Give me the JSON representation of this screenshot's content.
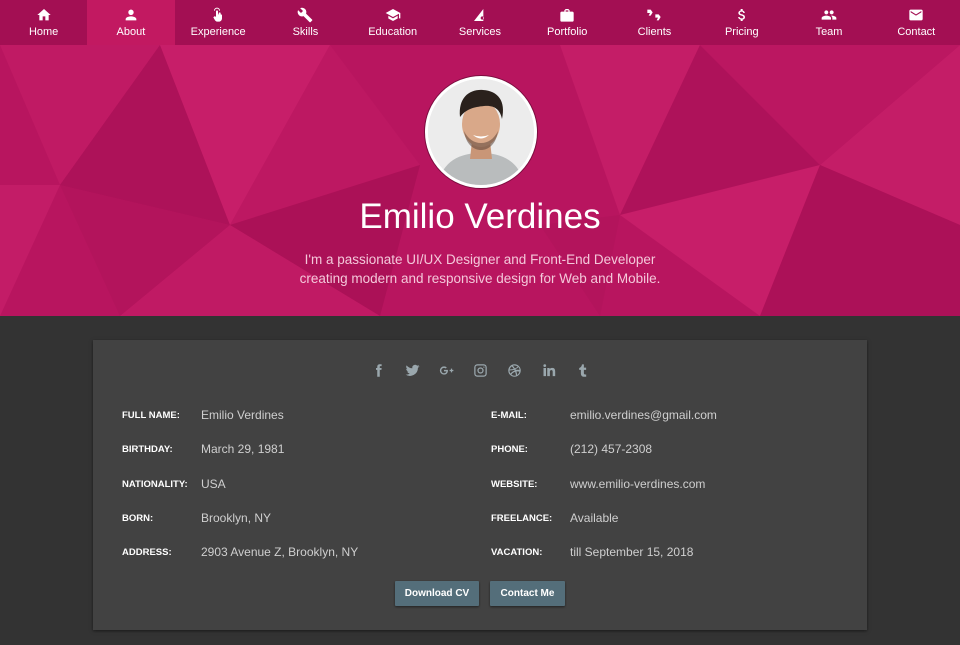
{
  "nav": [
    {
      "label": "Home",
      "icon": "home-icon"
    },
    {
      "label": "About",
      "icon": "person-icon"
    },
    {
      "label": "Experience",
      "icon": "hand-pointer-icon"
    },
    {
      "label": "Skills",
      "icon": "wrench-icon"
    },
    {
      "label": "Education",
      "icon": "graduation-cap-icon"
    },
    {
      "label": "Services",
      "icon": "services-icon"
    },
    {
      "label": "Portfolio",
      "icon": "briefcase-icon"
    },
    {
      "label": "Clients",
      "icon": "thumbs-icon"
    },
    {
      "label": "Pricing",
      "icon": "dollar-icon"
    },
    {
      "label": "Team",
      "icon": "team-icon"
    },
    {
      "label": "Contact",
      "icon": "mail-icon"
    }
  ],
  "active_nav": "About",
  "hero": {
    "name": "Emilio Verdines",
    "bio": "I'm a passionate UI/UX Designer and Front-End Developer creating modern and responsive design for Web and Mobile."
  },
  "social": [
    "facebook-icon",
    "twitter-icon",
    "google-plus-icon",
    "instagram-icon",
    "dribbble-icon",
    "linkedin-icon",
    "tumblr-icon"
  ],
  "info_left": [
    {
      "label": "FULL NAME:",
      "value": "Emilio Verdines"
    },
    {
      "label": "BIRTHDAY:",
      "value": "March 29, 1981"
    },
    {
      "label": "NATIONALITY:",
      "value": "USA"
    },
    {
      "label": "BORN:",
      "value": "Brooklyn, NY"
    },
    {
      "label": "ADDRESS:",
      "value": "2903 Avenue Z, Brooklyn, NY"
    }
  ],
  "info_right": [
    {
      "label": "E-MAIL:",
      "value": "emilio.verdines@gmail.com"
    },
    {
      "label": "PHONE:",
      "value": "(212) 457-2308"
    },
    {
      "label": "WEBSITE:",
      "value": "www.emilio-verdines.com"
    },
    {
      "label": "FREELANCE:",
      "value": "Available"
    },
    {
      "label": "VACATION:",
      "value": "till September 15, 2018"
    }
  ],
  "buttons": {
    "download": "Download CV",
    "contact": "Contact Me"
  },
  "colors": {
    "nav": "#a30f53",
    "hero": "#b8155f",
    "card": "#424242",
    "page": "#333333",
    "button": "#546e7a"
  }
}
